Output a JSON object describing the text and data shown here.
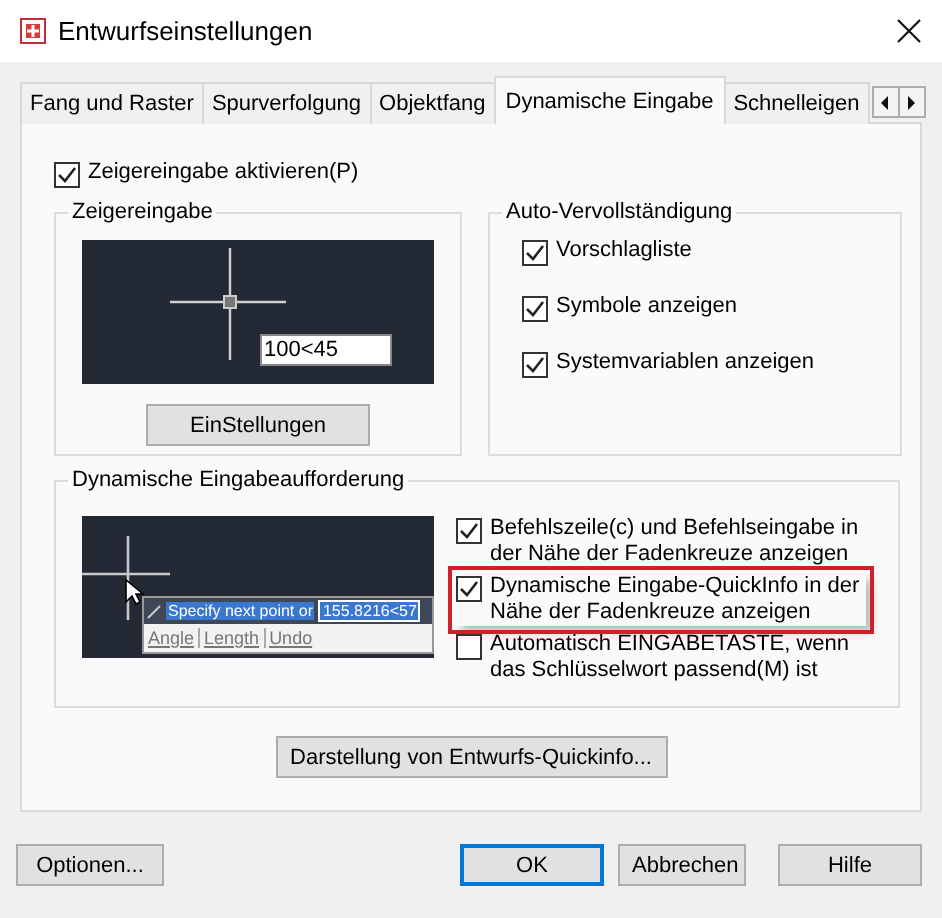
{
  "window": {
    "title": "Entwurfseinstellungen"
  },
  "tabs": [
    {
      "label": "Fang und Raster",
      "selected": false
    },
    {
      "label": "Spurverfolgung",
      "selected": false
    },
    {
      "label": "Objektfang",
      "selected": false
    },
    {
      "label": "Dynamische Eingabe",
      "selected": true
    },
    {
      "label": "Schnelleigen",
      "selected": false
    }
  ],
  "pointer_input_enabled": {
    "label": "Zeigereingabe aktivieren(P)",
    "checked": true
  },
  "pointer_input": {
    "title": "Zeigereingabe",
    "preview_value": "100<45",
    "button": "EinStellungen"
  },
  "auto_complete": {
    "title": "Auto-Vervollständigung",
    "options": [
      {
        "label": "Vorschlagliste",
        "checked": true
      },
      {
        "label": "Symbole anzeigen",
        "checked": true
      },
      {
        "label": "Systemvariablen anzeigen",
        "checked": true
      }
    ]
  },
  "dynamic_prompt": {
    "title": "Dynamische Eingabeaufforderung",
    "preview": {
      "prompt": "Specify next point or",
      "value": "155.8216<57",
      "options": [
        "Angle",
        "Length",
        "Undo"
      ]
    },
    "options": [
      {
        "label": "Befehlszeile(c) und Befehlseingabe in der Nähe der Fadenkreuze anzeigen",
        "checked": true,
        "highlighted": false
      },
      {
        "label": "Dynamische Eingabe-QuickInfo in der Nähe der Fadenkreuze anzeigen",
        "checked": true,
        "highlighted": true
      },
      {
        "label": "Automatisch EINGABETASTE, wenn das Schlüsselwort passend(M) ist",
        "checked": false,
        "highlighted": false
      }
    ]
  },
  "tooltip_button": "Darstellung von Entwurfs-Quickinfo...",
  "buttons": [
    {
      "label": "Optionen...",
      "default": false
    },
    {
      "label": "OK",
      "default": true
    },
    {
      "label": "Abbrechen",
      "default": false
    },
    {
      "label": "Hilfe",
      "default": false
    }
  ]
}
